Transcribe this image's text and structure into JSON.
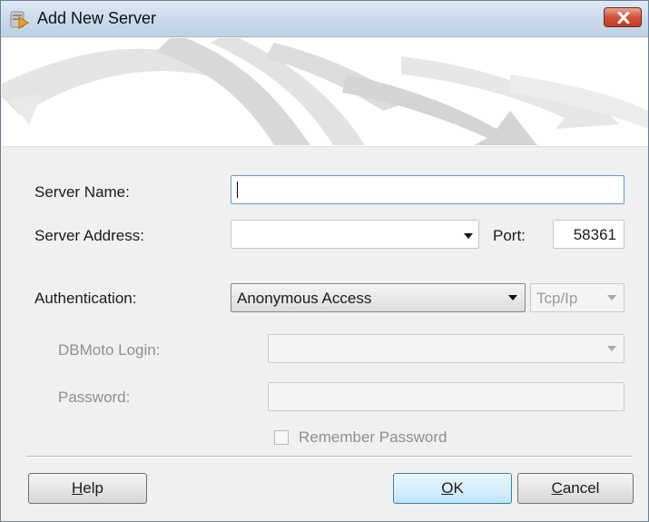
{
  "window": {
    "title": "Add New Server"
  },
  "form": {
    "server_name_label": "Server Name:",
    "server_name_value": "",
    "server_address_label": "Server Address:",
    "server_address_value": "",
    "port_label": "Port:",
    "port_value": "58361",
    "authentication_label": "Authentication:",
    "authentication_value": "Anonymous Access",
    "protocol_value": "Tcp/Ip",
    "login_label": "DBMoto Login:",
    "login_value": "",
    "password_label": "Password:",
    "password_value": "",
    "remember_password_label": "Remember Password",
    "remember_password_checked": false
  },
  "buttons": {
    "help": {
      "underlined": "H",
      "rest": "elp"
    },
    "ok": {
      "underlined": "O",
      "rest": "K"
    },
    "cancel": {
      "underlined": "C",
      "rest": "ancel"
    }
  },
  "icons": {
    "title_icon": "server-add-icon",
    "close_icon": "close-icon",
    "dropdown_icon": "chevron-down-icon"
  },
  "colors": {
    "close_button": "#d2533a",
    "focus_border": "#5b9ad8",
    "titlebar": "#c9d9ec"
  }
}
